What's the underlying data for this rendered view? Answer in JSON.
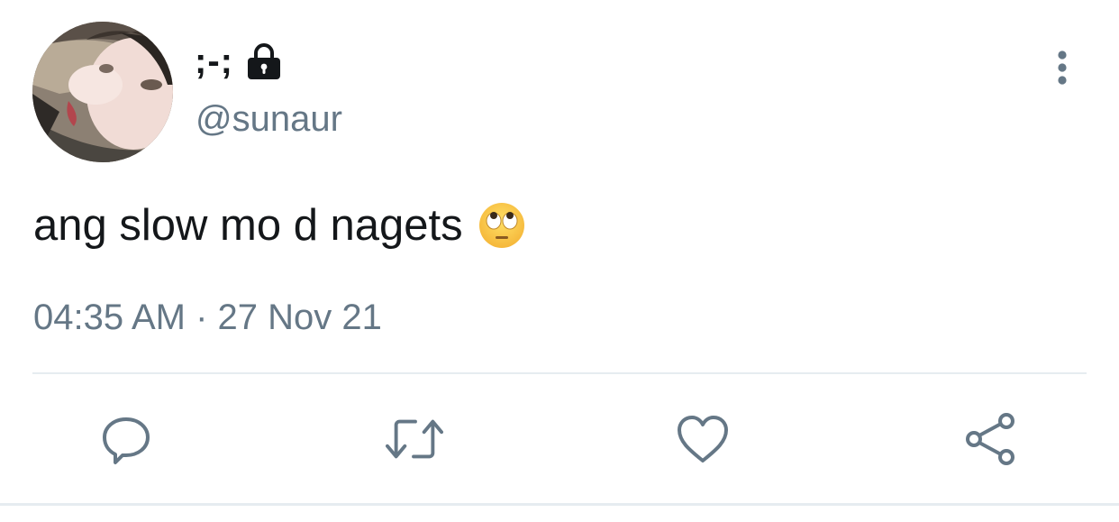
{
  "tweet": {
    "display_name": ";-;",
    "handle": "@sunaur",
    "text": "ang slow mo d nagets",
    "text_emoji": "face-with-rolling-eyes",
    "timestamp": "04:35 AM · 27 Nov 21",
    "protected_account": true
  },
  "icons": {
    "lock": "lock-icon",
    "more": "more-vertical-icon",
    "reply": "reply-icon",
    "retweet": "retweet-icon",
    "like": "heart-icon",
    "share": "share-icon"
  },
  "colors": {
    "text": "#14171a",
    "secondary": "#657786",
    "divider": "#e6ecf0"
  }
}
